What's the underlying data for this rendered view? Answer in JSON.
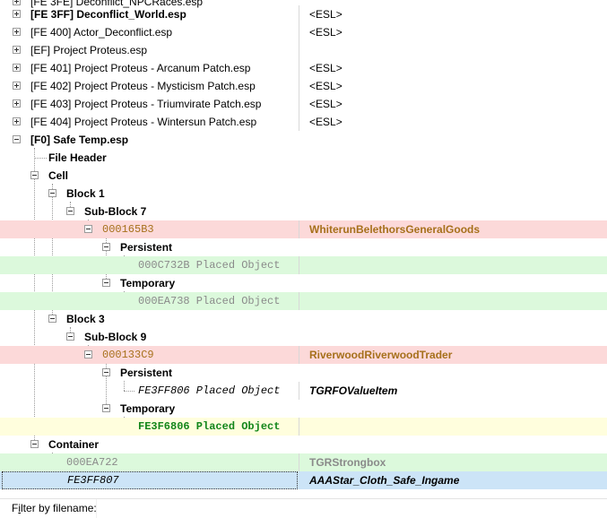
{
  "rows": [
    {
      "name": "[FE 3FF] Deconflict_World.esp",
      "value": "<ESL>"
    },
    {
      "name": "[FE 400] Actor_Deconflict.esp",
      "value": "<ESL>"
    },
    {
      "name": "[EF] Project Proteus.esp",
      "value": ""
    },
    {
      "name": "[FE 401] Project Proteus - Arcanum Patch.esp",
      "value": "<ESL>"
    },
    {
      "name": "[FE 402] Project Proteus - Mysticism Patch.esp",
      "value": "<ESL>"
    },
    {
      "name": "[FE 403] Project Proteus - Triumvirate Patch.esp",
      "value": "<ESL>"
    },
    {
      "name": "[FE 404] Project Proteus - Wintersun Patch.esp",
      "value": "<ESL>"
    },
    {
      "name": "[F0] Safe Temp.esp",
      "value": ""
    },
    {
      "name": "File Header",
      "value": ""
    },
    {
      "name": "Cell",
      "value": ""
    },
    {
      "name": "Block 1",
      "value": ""
    },
    {
      "name": "Sub-Block 7",
      "value": ""
    },
    {
      "name": "000165B3",
      "value": "WhiterunBelethorsGeneralGoods"
    },
    {
      "name": "Persistent",
      "value": ""
    },
    {
      "name": "000C732B  Placed Object",
      "value": ""
    },
    {
      "name": "Temporary",
      "value": ""
    },
    {
      "name": "000EA738  Placed Object",
      "value": ""
    },
    {
      "name": "Block 3",
      "value": ""
    },
    {
      "name": "Sub-Block 9",
      "value": ""
    },
    {
      "name": "000133C9",
      "value": "RiverwoodRiverwoodTrader"
    },
    {
      "name": "Persistent",
      "value": ""
    },
    {
      "name": "FE3FF806  Placed Object",
      "value": "TGRFOValueItem"
    },
    {
      "name": "Temporary",
      "value": ""
    },
    {
      "name": "FE3F6806  Placed Object",
      "value": ""
    },
    {
      "name": "Container",
      "value": ""
    },
    {
      "name": "000EA722",
      "value": "TGRStrongbox"
    },
    {
      "name": "FE3FF807",
      "value": "AAAStar_Cloth_Safe_Ingame"
    }
  ],
  "filter": {
    "label_first": "F",
    "label_underlined": "i",
    "label_rest": "lter by filename:",
    "value": ""
  },
  "colors": {
    "conflict_row": "#fcd9d9",
    "override_row": "#dcf9dc",
    "injected_row": "#fffedd",
    "selected_row": "#cce4f7"
  }
}
